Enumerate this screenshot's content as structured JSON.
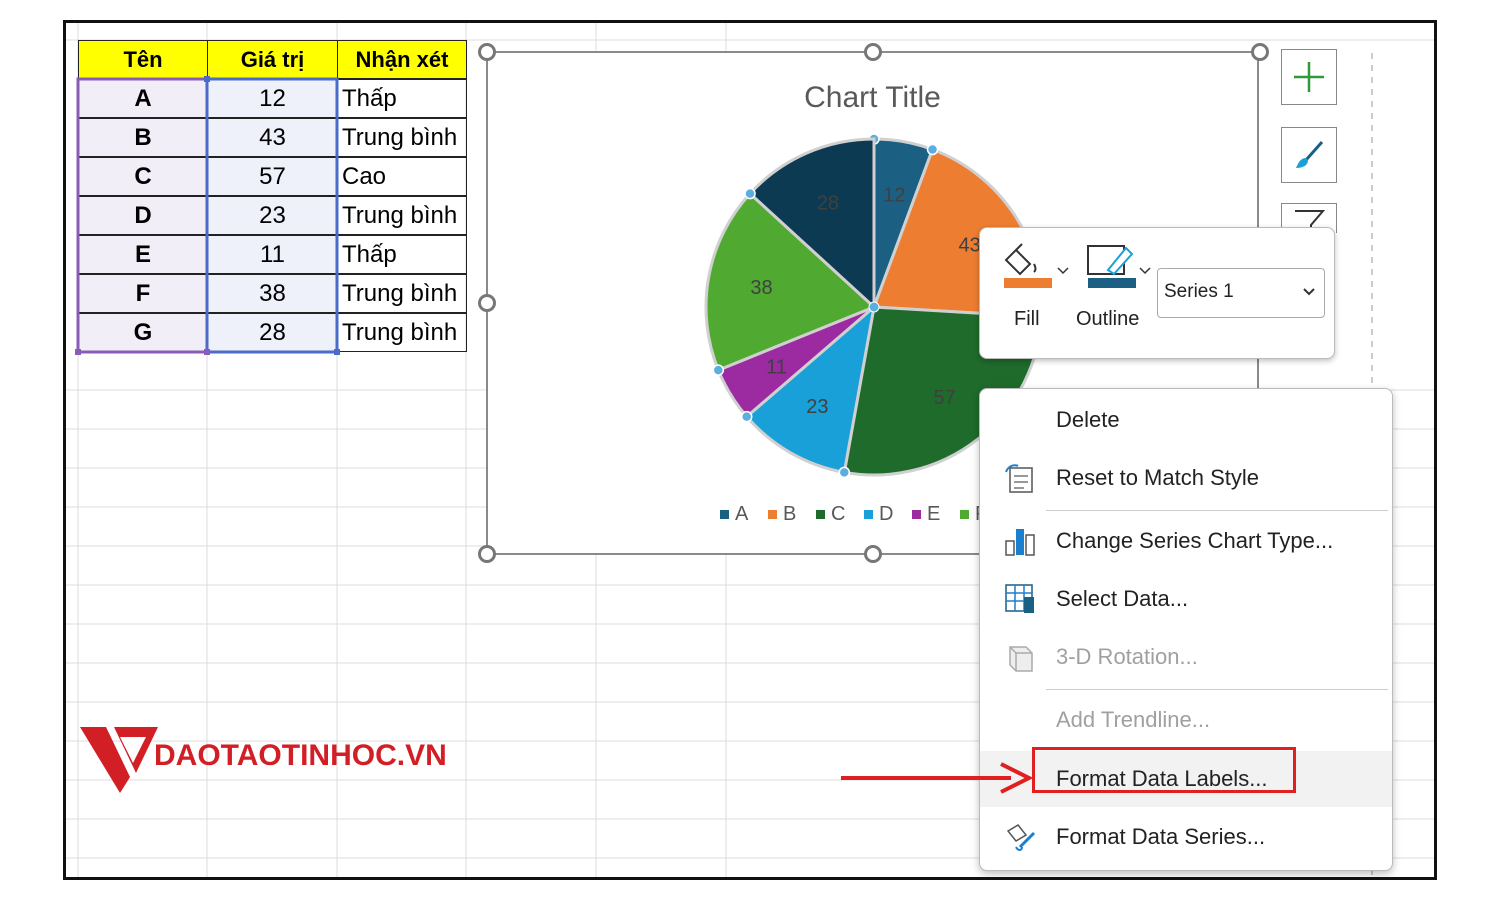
{
  "table": {
    "headers": [
      "Tên",
      "Giá trị",
      "Nhận xét"
    ],
    "rows": [
      {
        "name": "A",
        "value": "12",
        "note": "Thấp"
      },
      {
        "name": "B",
        "value": "43",
        "note": "Trung bình"
      },
      {
        "name": "C",
        "value": "57",
        "note": "Cao"
      },
      {
        "name": "D",
        "value": "23",
        "note": "Trung bình"
      },
      {
        "name": "E",
        "value": "11",
        "note": "Thấp"
      },
      {
        "name": "F",
        "value": "38",
        "note": "Trung bình"
      },
      {
        "name": "G",
        "value": "28",
        "note": "Trung bình"
      }
    ]
  },
  "chart": {
    "title": "Chart Title",
    "legend": [
      "A",
      "B",
      "C",
      "D",
      "E",
      "F"
    ]
  },
  "chart_data": {
    "type": "pie",
    "title": "Chart Title",
    "categories": [
      "A",
      "B",
      "C",
      "D",
      "E",
      "F",
      "G"
    ],
    "values": [
      12,
      43,
      57,
      23,
      11,
      38,
      28
    ],
    "colors": [
      "#1b5f82",
      "#ed7d31",
      "#1e6b2b",
      "#1aa0d8",
      "#9c2aa0",
      "#50aa32",
      "#0c3a52"
    ],
    "legend_position": "bottom"
  },
  "mini_toolbar": {
    "fill_label": "Fill",
    "outline_label": "Outline",
    "series_value": "Series 1",
    "fill_color": "#ed7d31",
    "outline_color": "#1b5f82"
  },
  "context_menu": {
    "items": [
      {
        "label": "Delete",
        "icon": "none",
        "enabled": true
      },
      {
        "label": "Reset to Match Style",
        "icon": "reset-style-icon",
        "enabled": true
      },
      {
        "label": "Change Series Chart Type...",
        "icon": "chart-type-icon",
        "enabled": true
      },
      {
        "label": "Select Data...",
        "icon": "select-data-icon",
        "enabled": true
      },
      {
        "label": "3-D Rotation...",
        "icon": "rotation-3d-icon",
        "enabled": false
      },
      {
        "label": "Add Trendline...",
        "icon": "none",
        "enabled": false
      },
      {
        "label": "Format Data Labels...",
        "icon": "none",
        "enabled": true
      },
      {
        "label": "Format Data Series...",
        "icon": "format-series-icon",
        "enabled": true
      }
    ]
  },
  "watermark": {
    "text": "DAOTAOTINHOC.VN"
  },
  "colors": {
    "header_bg": "#ffff00",
    "highlight": "#e02020"
  }
}
